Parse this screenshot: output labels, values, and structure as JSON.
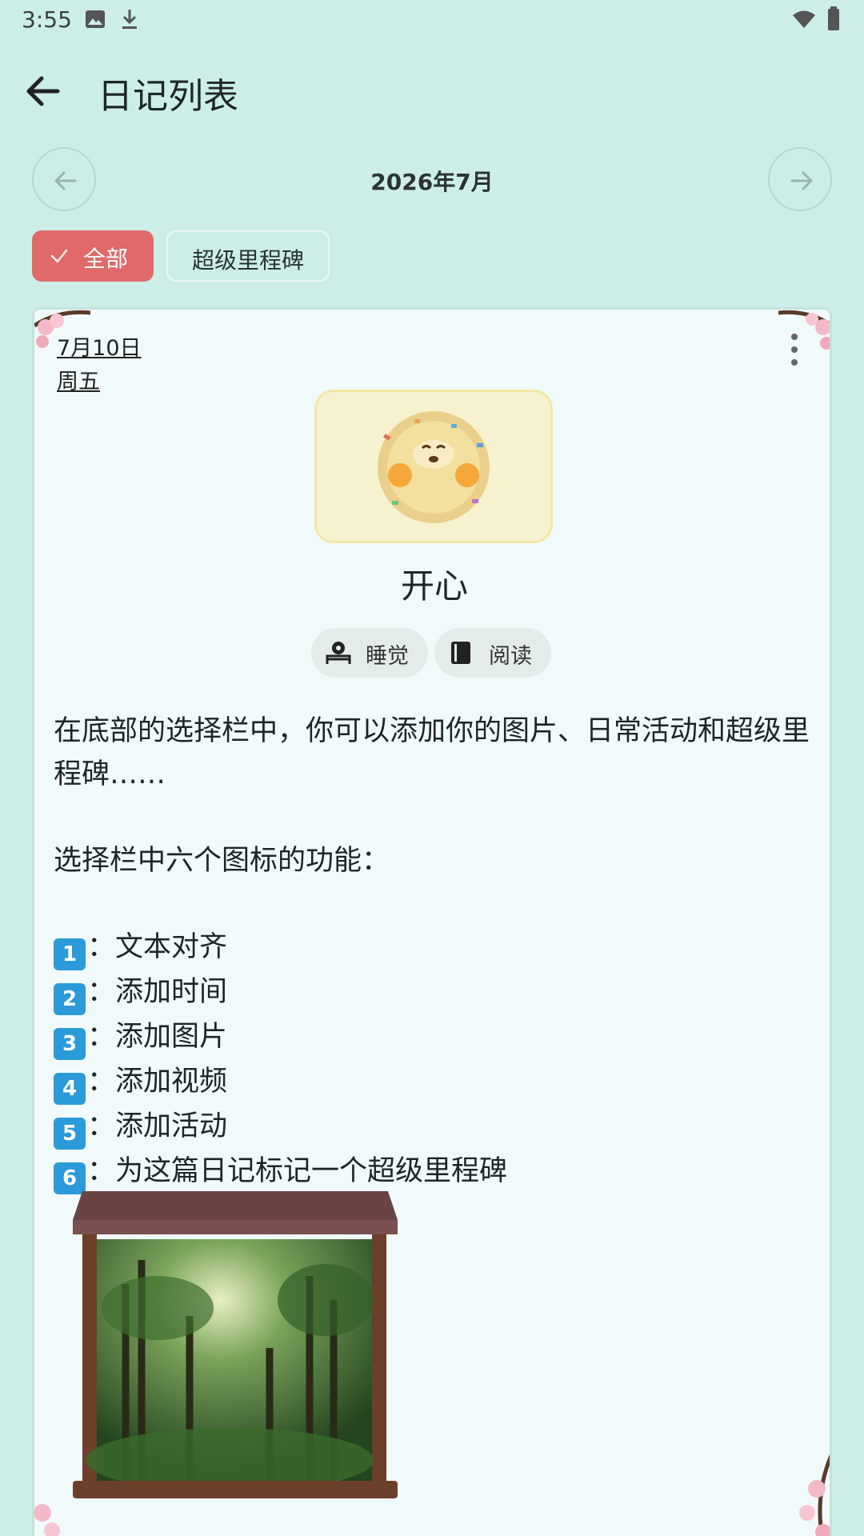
{
  "status_bar": {
    "time": "3:55"
  },
  "app_bar": {
    "title": "日记列表"
  },
  "month_nav": {
    "label": "2026年7月"
  },
  "filters": {
    "all": "全部",
    "milestone": "超级里程碑"
  },
  "entry": {
    "date": "7月10日",
    "weekday": "周五",
    "mood": "开心",
    "tags": [
      {
        "icon": "sleep-icon",
        "label": "睡觉"
      },
      {
        "icon": "book-icon",
        "label": "阅读"
      }
    ],
    "paragraph1": "在底部的选择栏中，你可以添加你的图片、日常活动和超级里程碑……",
    "paragraph2": "选择栏中六个图标的功能：",
    "list": [
      {
        "num": "1",
        "text": "文本对齐"
      },
      {
        "num": "2",
        "text": "添加时间"
      },
      {
        "num": "3",
        "text": "添加图片"
      },
      {
        "num": "4",
        "text": "添加视频"
      },
      {
        "num": "5",
        "text": "添加活动"
      },
      {
        "num": "6",
        "text": "为这篇日记标记一个超级里程碑"
      }
    ],
    "list_separator": "："
  },
  "colors": {
    "background": "#cdeee8",
    "accent": "#e06a6a",
    "card": "#f1fafa"
  }
}
